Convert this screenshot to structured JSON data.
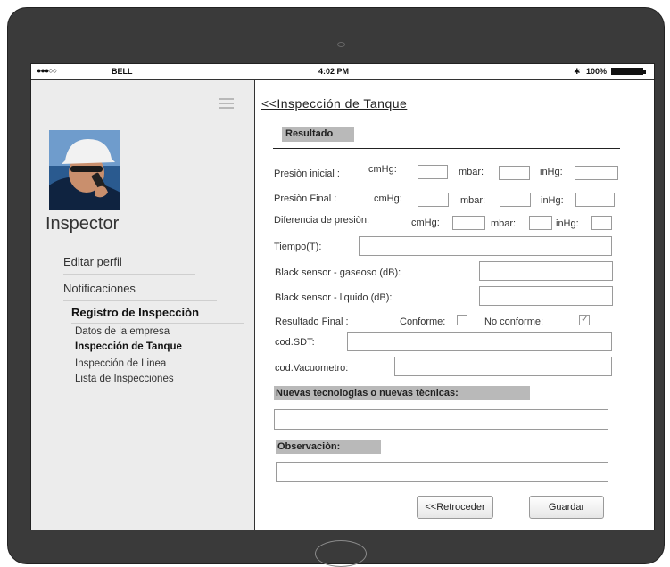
{
  "status_bar": {
    "signal": "●●●○○",
    "carrier": "BELL",
    "time": "4:02 PM",
    "battery": "100%",
    "battery_level": 1.0,
    "bluetooth": "✱"
  },
  "sidebar": {
    "title": "Inspector",
    "links": {
      "edit_profile": "Editar perfil",
      "notifications": "Notificaciones"
    },
    "section_heading": "Registro de Inspecciòn",
    "sub_items": [
      "Datos de la empresa",
      "Inspección de Tanque",
      "Inspección de Linea",
      "Lista de Inspecciones"
    ],
    "active_sub_item": "Inspección de Tanque"
  },
  "main": {
    "title": "<<Inspección de Tanque",
    "result_tab": "Resultado",
    "presion_inicial": {
      "label": "Presiòn inicial  :",
      "cmhg": "cmHg:",
      "mbar": "mbar:",
      "inhg": "inHg:"
    },
    "presion_final": {
      "label": "Presiòn Final  :",
      "cmhg": "cmHg:",
      "mbar": "mbar:",
      "inhg": "inHg:"
    },
    "diferencia": {
      "label": "Diferencia de presiòn:",
      "cmhg": "cmHg:",
      "mbar": "mbar:",
      "inhg": "inHg:"
    },
    "tiempo_label": "Tiempo(T):",
    "gaseoso_label": "Black sensor - gaseoso (dB):",
    "liquido_label": "Black sensor - liquido (dB):",
    "resultado_final": {
      "label": "Resultado Final  :",
      "conforme": "Conforme:",
      "no_conforme": "No conforme:",
      "conforme_checked": false,
      "no_conforme_checked": true
    },
    "sdt_label": "cod.SDT:",
    "vacuometro_label": "cod.Vacuometro:",
    "nuevas_label": "Nuevas tecnologias o nuevas tècnicas:",
    "observacion_label": "Observaciòn:",
    "back_button": "<<Retroceder",
    "save_button": "Guardar"
  }
}
